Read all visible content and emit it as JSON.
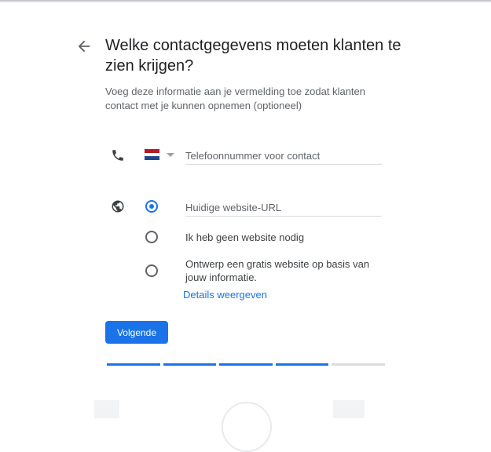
{
  "header": {
    "back_icon": "arrow-back-icon",
    "title": "Welke contactgegevens moeten klanten te zien krijgen?",
    "subtitle": "Voeg deze informatie aan je vermelding toe zodat klanten contact met je kunnen opnemen (optioneel)"
  },
  "phone": {
    "icon": "phone-icon",
    "country_flag": "netherlands-flag-icon",
    "flag_colors": [
      "#ae1c28",
      "#ffffff",
      "#21468b"
    ],
    "placeholder": "Telefoonnummer voor contact",
    "value": ""
  },
  "website": {
    "icon": "globe-icon",
    "options": [
      {
        "label": "",
        "placeholder": "Huidige website-URL",
        "selected": true
      },
      {
        "label": "Ik heb geen website nodig",
        "selected": false
      },
      {
        "label": "Ontwerp een gratis website op basis van jouw informatie.",
        "selected": false
      }
    ],
    "details_link": "Details weergeven"
  },
  "actions": {
    "next_label": "Volgende"
  },
  "progress": {
    "steps_total": 5,
    "steps_completed": 4,
    "active_color": "#1a73e8",
    "inactive_color": "#dadce0"
  },
  "colors": {
    "accent": "#1a73e8",
    "text_primary": "#202124",
    "text_secondary": "#5f6368"
  }
}
